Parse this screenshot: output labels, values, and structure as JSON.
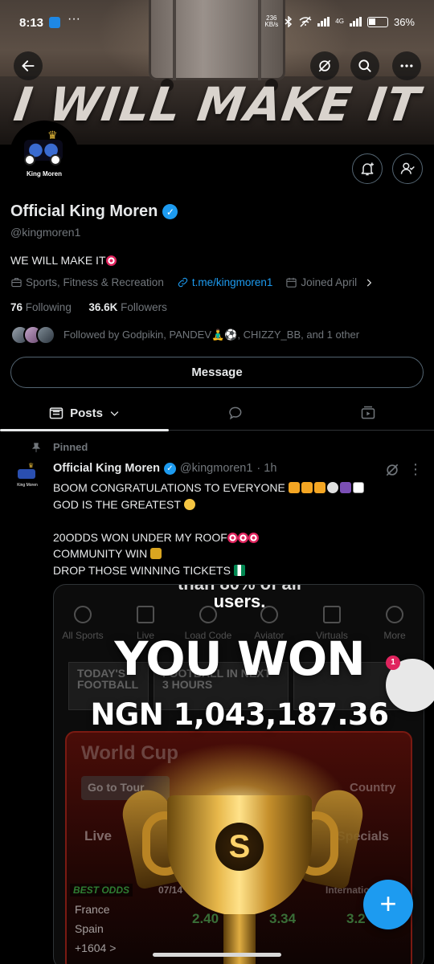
{
  "status_bar": {
    "time": "8:13",
    "dots": "···",
    "net_speed": "236\nKB/s",
    "network": "4G",
    "battery": "36%"
  },
  "banner": {
    "slogan": "I WILL MAKE IT"
  },
  "profile": {
    "avatar_text": "King Moren",
    "display_name": "Official King Moren",
    "handle": "@kingmoren1",
    "bio": "WE WILL MAKE IT",
    "category": "Sports, Fitness & Recreation",
    "link": "t.me/kingmoren1",
    "joined": "Joined April",
    "following_count": "76",
    "following_label": "Following",
    "followers_count": "36.6K",
    "followers_label": "Followers",
    "followed_by": "Followed by Godpikin, PANDEV🧘‍♂️⚽, CHIZZY_BB, and 1 other",
    "message_label": "Message"
  },
  "tabs": {
    "posts_label": "Posts"
  },
  "post": {
    "pinned_label": "Pinned",
    "author": "Official King Moren",
    "handle": "@kingmoren1",
    "time": "· 1h",
    "line1": "BOOM CONGRATULATIONS TO EVERYONE",
    "line2": "GOD IS THE GREATEST",
    "line3": "20ODDS WON UNDER MY ROOF",
    "line4": "COMMUNITY WIN",
    "line5": "DROP THOSE WINNING TICKETS",
    "avatar_text": "King Moren"
  },
  "media": {
    "top_partial": "than 80% of all",
    "users": "users.",
    "nav": [
      "All Sports",
      "Live",
      "Load Code",
      "Aviator",
      "Virtuals",
      "More"
    ],
    "tab1": "TODAY'S FOOTBALL",
    "tab2": "FOOTBALL IN NEXT 3 HOURS",
    "world": "World Cup",
    "goto": "Go to Tour",
    "country": "Country",
    "live": "Live",
    "specials": "Specials",
    "best_odds": "BEST ODDS",
    "date": "07/14",
    "international": "International",
    "team1": "France",
    "team2": "Spain",
    "more_markets": "+1604 >",
    "odds": [
      "2.40",
      "3.34",
      "3.2"
    ],
    "you_won": "YOU WON",
    "amount": "NGN 1,043,187.36"
  },
  "floating": {
    "badge": "1",
    "fab": "+"
  }
}
